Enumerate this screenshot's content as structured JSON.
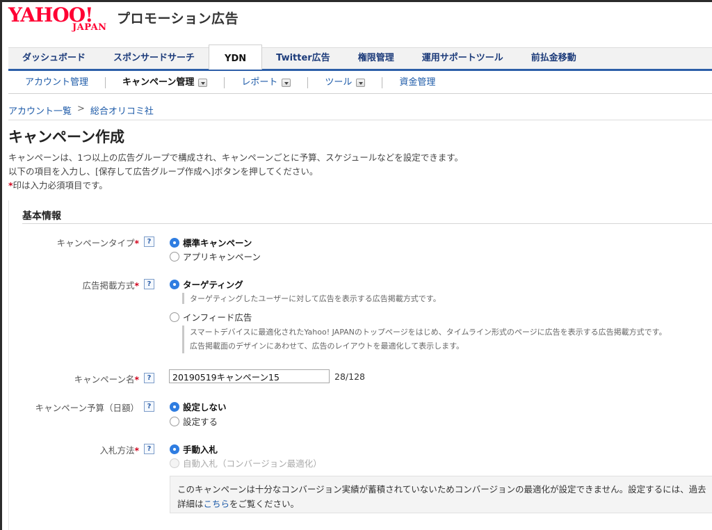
{
  "header": {
    "logo_main": "YAHOO!",
    "logo_sub": "JAPAN",
    "product_name": "プロモーション広告"
  },
  "main_tabs": [
    {
      "label": "ダッシュボード"
    },
    {
      "label": "スポンサードサーチ"
    },
    {
      "label": "YDN",
      "active": true
    },
    {
      "label": "Twitter広告"
    },
    {
      "label": "権限管理"
    },
    {
      "label": "運用サポートツール"
    },
    {
      "label": "前払金移動"
    }
  ],
  "sub_tabs": [
    {
      "label": "アカウント管理"
    },
    {
      "label": "キャンペーン管理",
      "active": true,
      "dropdown": true
    },
    {
      "label": "レポート",
      "dropdown": true
    },
    {
      "label": "ツール",
      "dropdown": true
    },
    {
      "label": "資金管理"
    }
  ],
  "breadcrumb": {
    "items": [
      "アカウント一覧",
      "総合オリコミ社"
    ],
    "separator": ">"
  },
  "page": {
    "title": "キャンペーン作成",
    "desc_line1": "キャンペーンは、1つ以上の広告グループで構成され、キャンペーンごとに予算、スケジュールなどを設定できます。",
    "desc_line2": "以下の項目を入力し、[保存して広告グループ作成へ]ボタンを押してください。",
    "required_mark": "*",
    "required_note": "印は入力必須項目です。"
  },
  "section": {
    "title": "基本情報"
  },
  "help_label": "?",
  "fields": {
    "campaign_type": {
      "label": "キャンペーンタイプ",
      "required": "*",
      "options": [
        "標準キャンペーン",
        "アプリキャンペーン"
      ],
      "selected": "標準キャンペーン"
    },
    "ad_delivery": {
      "label": "広告掲載方式",
      "required": "*",
      "options": [
        "ターゲティング",
        "インフィード広告"
      ],
      "selected": "ターゲティング",
      "note_targeting": "ターゲティングしたユーザーに対して広告を表示する広告掲載方式です。",
      "note_infeed_1": "スマートデバイスに最適化されたYahoo! JAPANのトップページをはじめ、タイムライン形式のページに広告を表示する広告掲載方式です。",
      "note_infeed_2": "広告掲載面のデザインにあわせて、広告のレイアウトを最適化して表示します。"
    },
    "campaign_name": {
      "label": "キャンペーン名",
      "required": "*",
      "value": "20190519キャンペーン15",
      "count": "28/128"
    },
    "campaign_budget": {
      "label": "キャンペーン予算（日額）",
      "options": [
        "設定しない",
        "設定する"
      ],
      "selected": "設定しない"
    },
    "bidding": {
      "label": "入札方法",
      "required": "*",
      "options": [
        "手動入札",
        "自動入札（コンバージョン最適化）"
      ],
      "selected": "手動入札"
    }
  },
  "info_box": {
    "line1": "このキャンペーンは十分なコンバージョン実績が蓄積されていないためコンバージョンの最適化が設定できません。設定するには、過去",
    "line2_prefix": "詳細は",
    "link": "こちら",
    "line2_suffix": "をご覧ください。"
  }
}
